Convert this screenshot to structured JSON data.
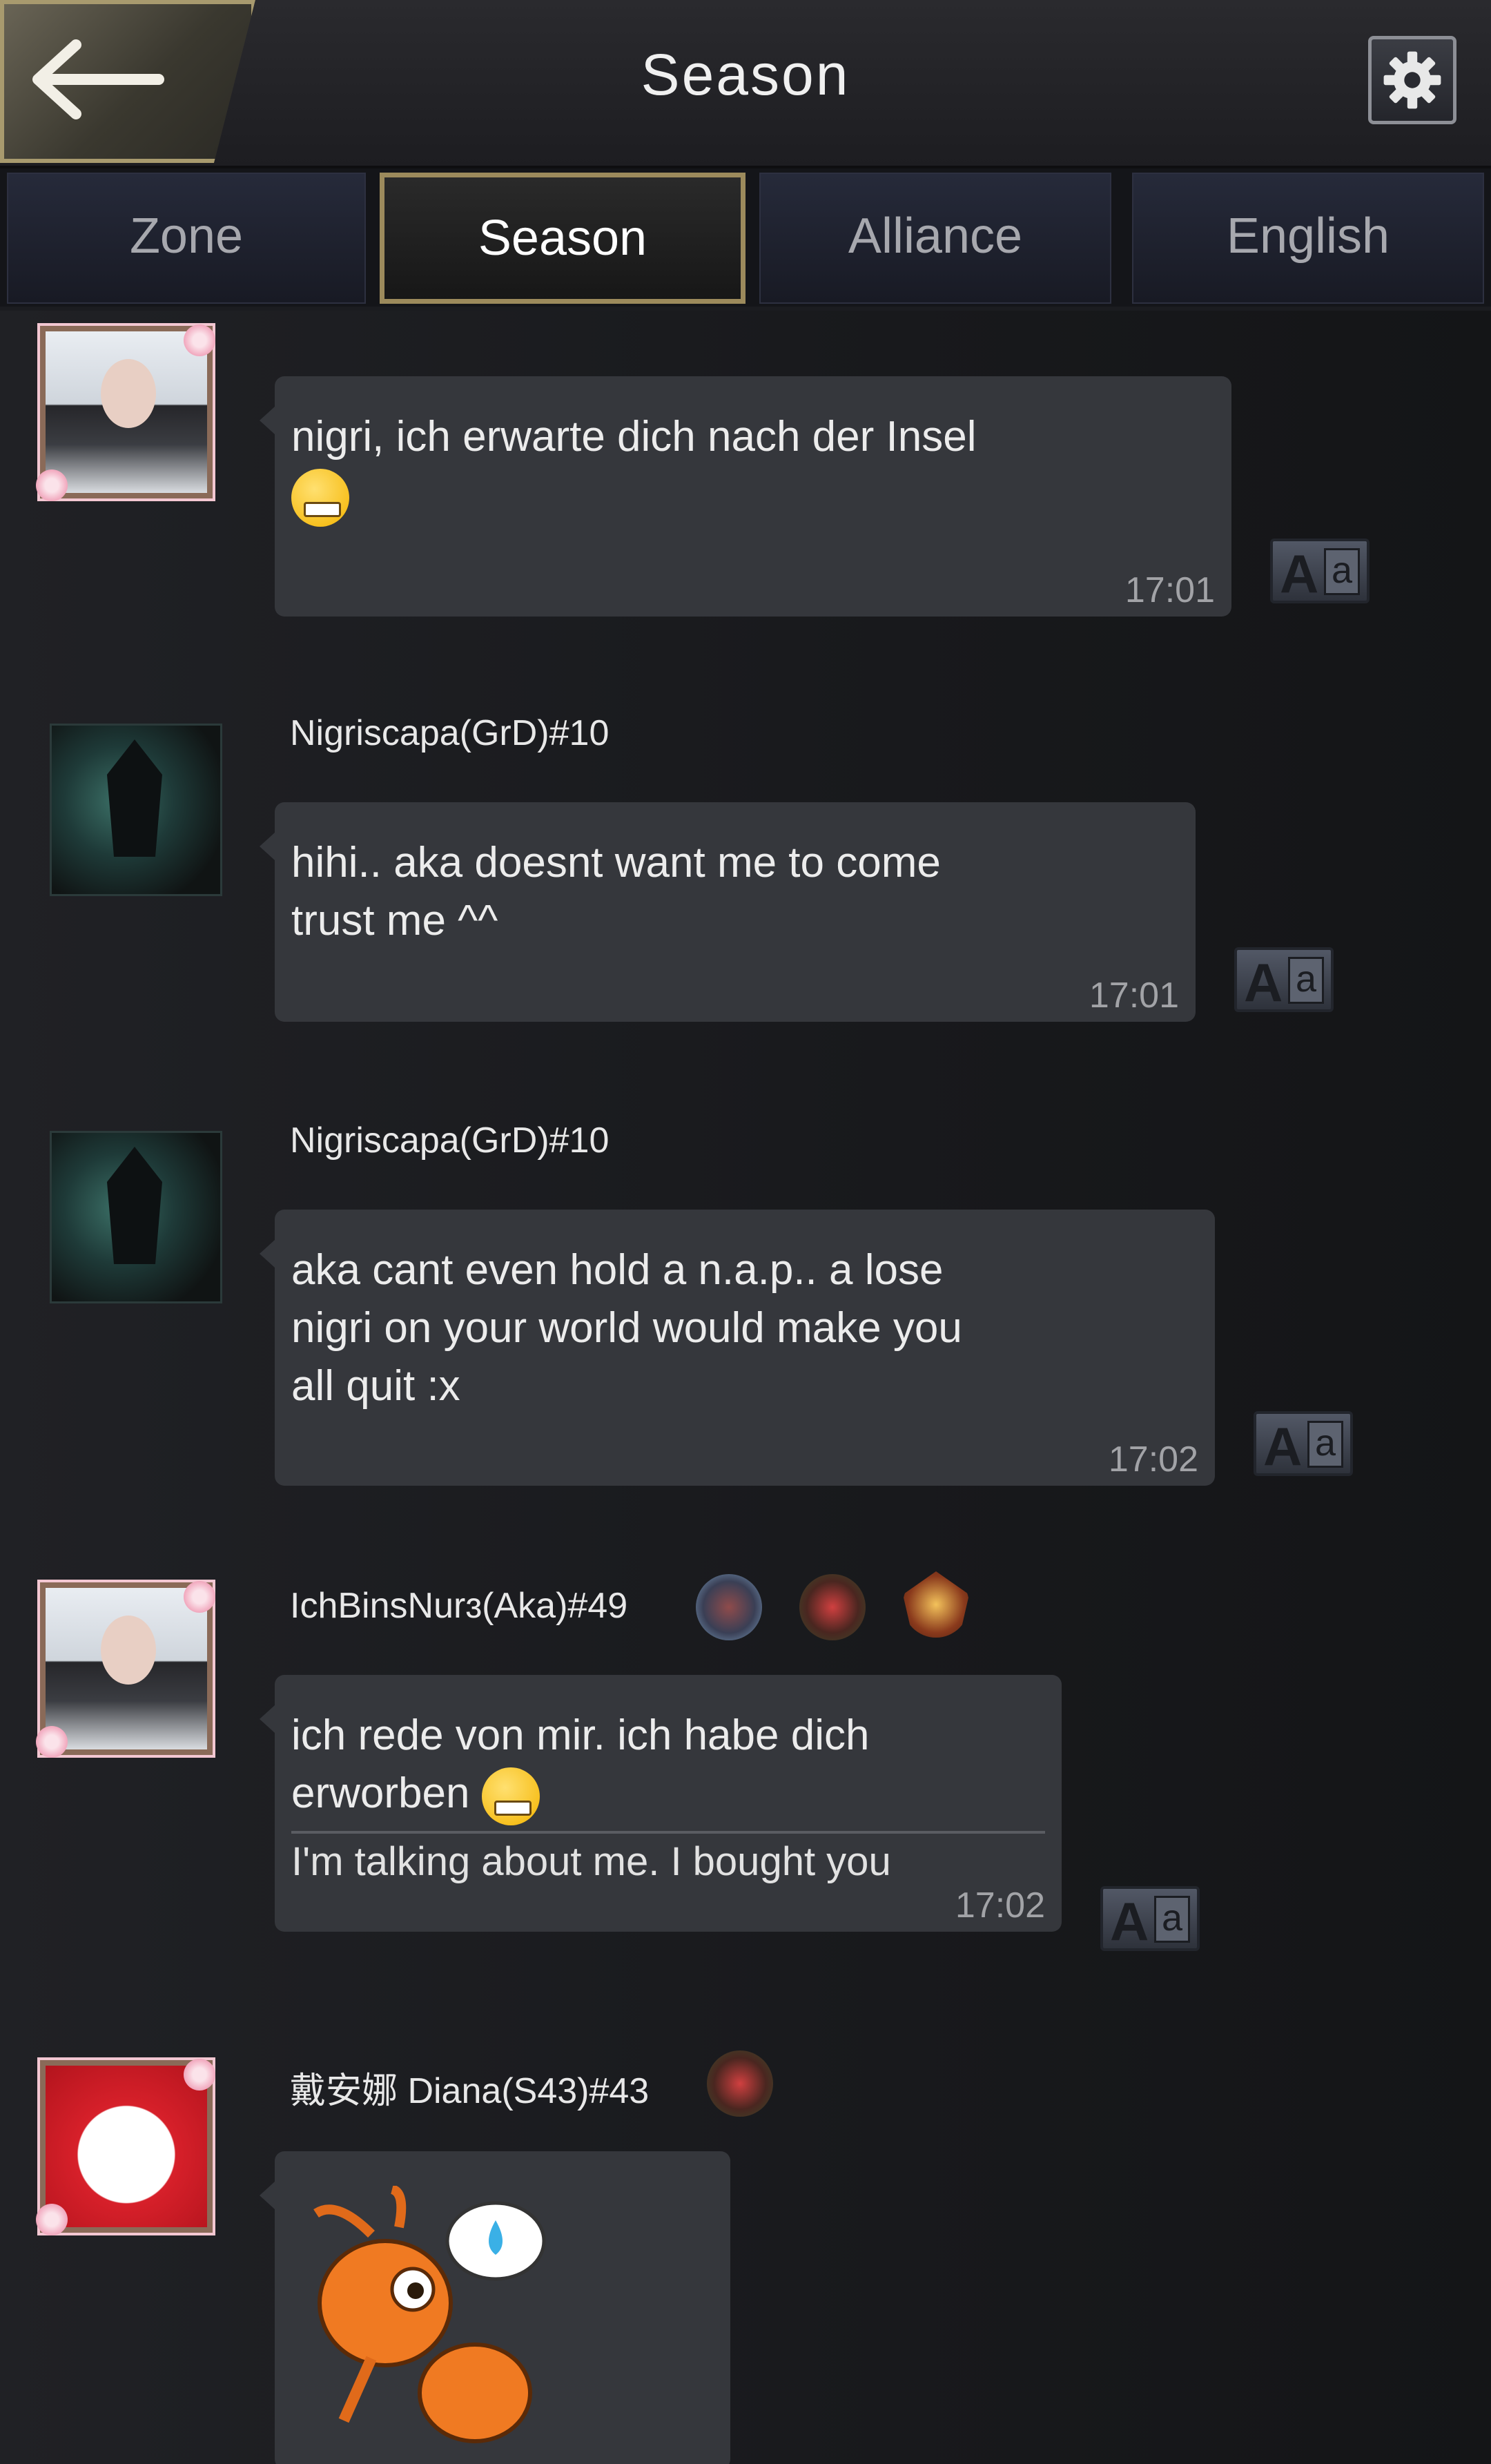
{
  "header": {
    "title": "Season"
  },
  "tabs": [
    {
      "label": "Zone",
      "active": false
    },
    {
      "label": "Season",
      "active": true
    },
    {
      "label": "Alliance",
      "active": false
    },
    {
      "label": "English",
      "active": false
    }
  ],
  "messages": [
    {
      "sender": "",
      "text_lines": [
        "nigri, ich erwarte dich nach der Insel"
      ],
      "emoji": "grinning-face",
      "time": "17:01",
      "translate_label": "Aa"
    },
    {
      "sender": "Nigriscapa(GrD)#10",
      "text_lines": [
        "hihi.. aka doesnt want me to come",
        "trust me ^^"
      ],
      "time": "17:01",
      "translate_label": "Aa"
    },
    {
      "sender": "Nigriscapa(GrD)#10",
      "text_lines": [
        "aka cant even hold a n.a.p.. a lose",
        "nigri on your world would make you",
        "all quit :x"
      ],
      "time": "17:02",
      "translate_label": "Aa"
    },
    {
      "sender": "IchBinsNurɜ(Aka)#49",
      "text_lines": [
        "ich rede von mir. ich habe dich",
        "erworben"
      ],
      "emoji": "sweat-smile-face",
      "translation": "I'm talking about me. I bought you",
      "time": "17:02",
      "translate_label": "Aa"
    },
    {
      "sender": "戴安娜 Diana(S43)#43",
      "sticker": "ant-sweat-sticker"
    }
  ],
  "icons": {
    "back": "back-arrow-icon",
    "settings": "gear-icon"
  },
  "colors": {
    "gold_border": "#9c8a5c",
    "bubble": "#35373c",
    "background": "#1b1c20"
  }
}
